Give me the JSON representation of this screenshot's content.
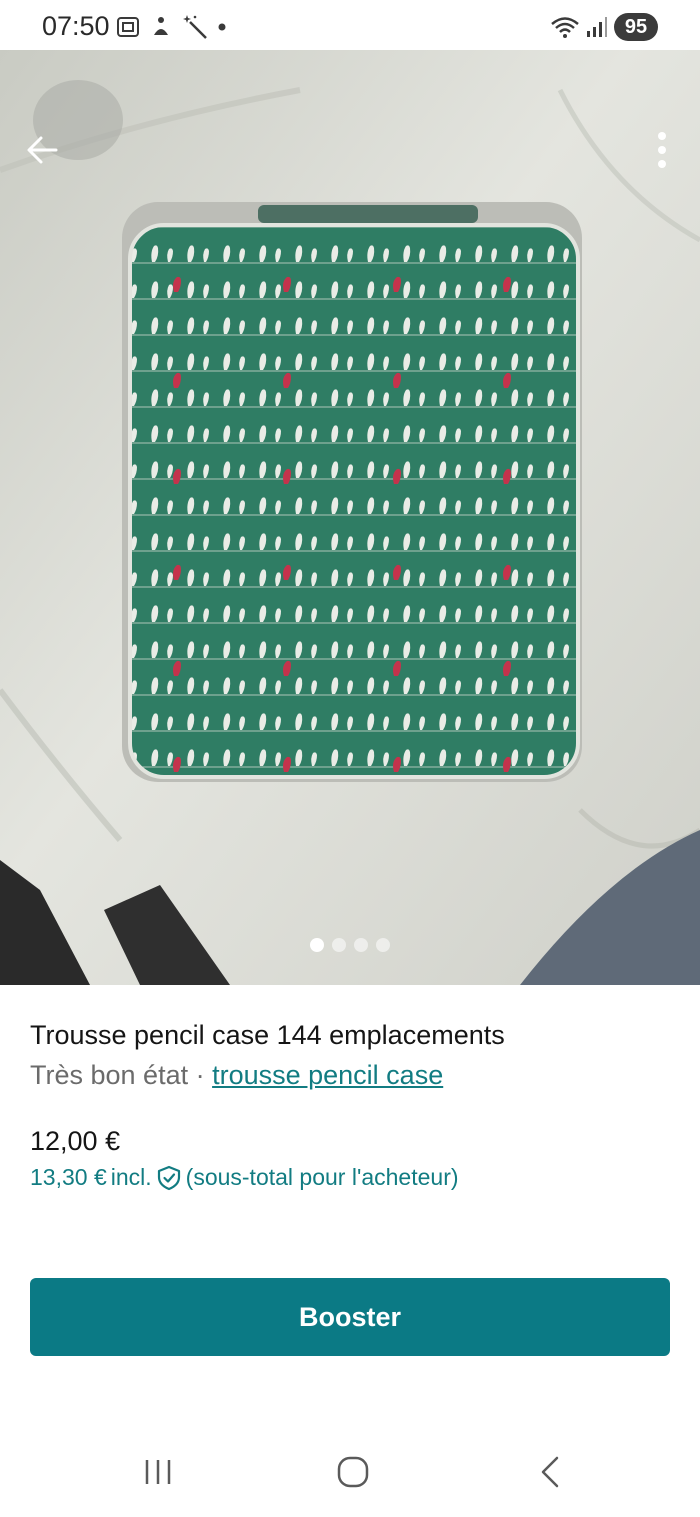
{
  "status_bar": {
    "time": "07:50",
    "battery": "95"
  },
  "product": {
    "title": "Trousse pencil case 144 emplacements",
    "condition": "Très bon état",
    "separator": " · ",
    "category_link": "trousse pencil case",
    "price": "12,00 €",
    "price_incl_amount": "13,30 €",
    "price_incl_label": "incl.",
    "price_incl_note": "(sous-total pour l'acheteur)"
  },
  "gallery": {
    "total_images": 4,
    "active_index": 0
  },
  "actions": {
    "booster_label": "Booster"
  },
  "colors": {
    "accent": "#0b7a85",
    "link": "#127c82",
    "bag_green": "#2f7d64",
    "bird_white": "#e9ece6",
    "bird_red": "#c4334c"
  },
  "icons": {
    "back": "arrow-left-icon",
    "more": "more-vertical-icon",
    "protection": "shield-check-icon",
    "nav_recents": "recents-icon",
    "nav_home": "home-icon",
    "nav_back": "chevron-left-icon"
  }
}
